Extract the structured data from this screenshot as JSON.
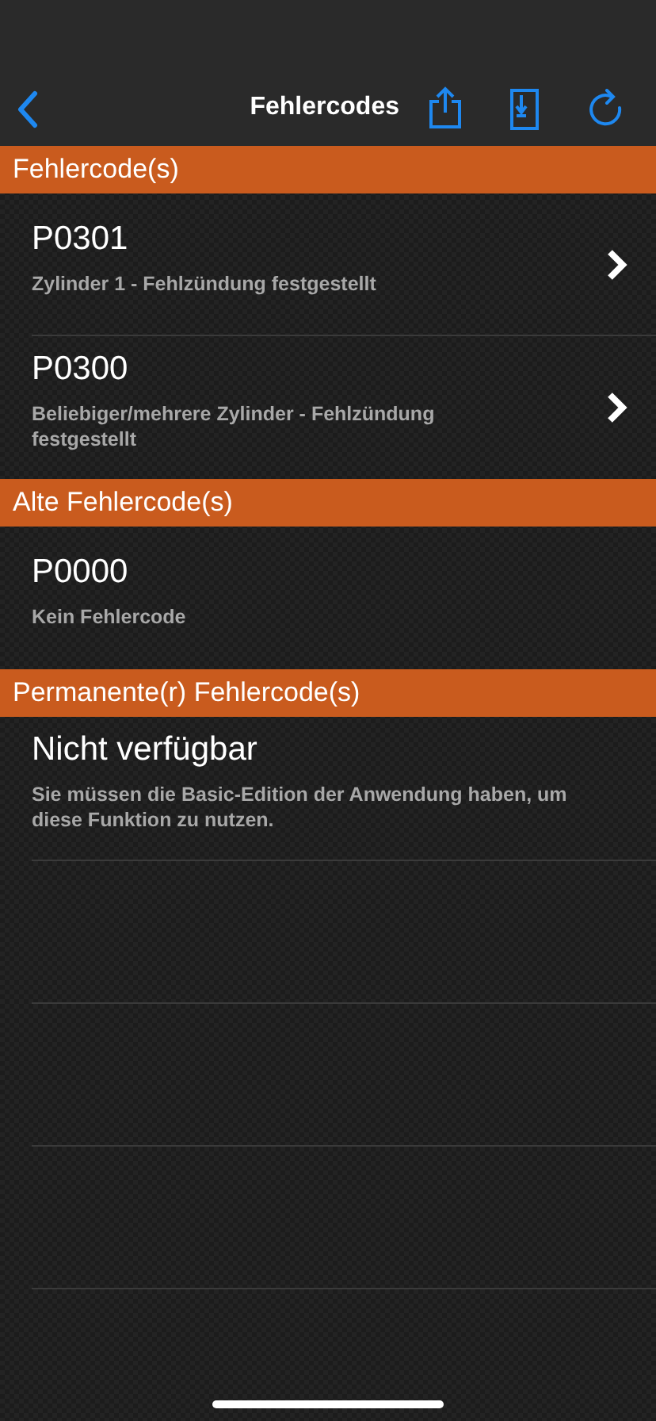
{
  "nav": {
    "title": "Fehlercodes"
  },
  "sections": [
    {
      "header": "Fehlercode(s)",
      "items": [
        {
          "code": "P0301",
          "description": "Zylinder 1 - Fehlzündung festgestellt",
          "has_detail": true
        },
        {
          "code": "P0300",
          "description": "Beliebiger/mehrere Zylinder - Fehlzündung festgestellt",
          "has_detail": true
        }
      ]
    },
    {
      "header": "Alte Fehlercode(s)",
      "items": [
        {
          "code": "P0000",
          "description": "Kein Fehlercode",
          "has_detail": false
        }
      ]
    },
    {
      "header": "Permanente(r) Fehlercode(s)",
      "items": [
        {
          "code": "Nicht verfügbar",
          "description": "Sie müssen die Basic-Edition der Anwendung haben, um diese Funktion zu nutzen.",
          "has_detail": false
        }
      ]
    }
  ]
}
